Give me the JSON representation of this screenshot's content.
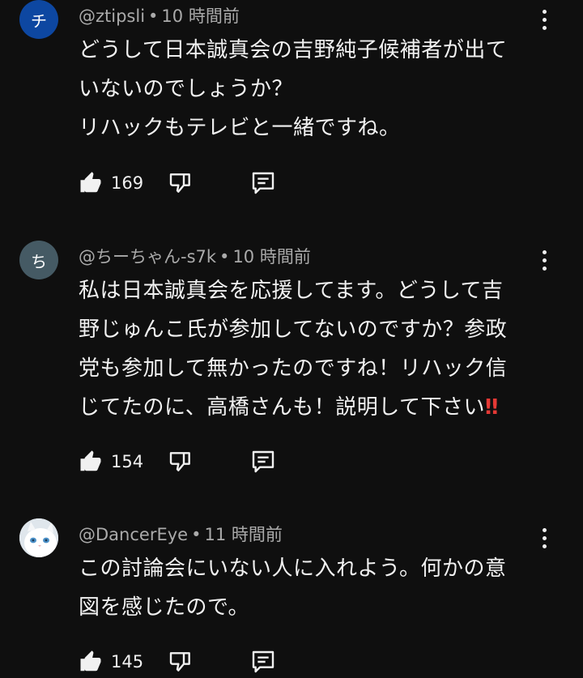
{
  "comments": [
    {
      "avatar_letter": "チ",
      "avatar_color": "#0d47a1",
      "author": "@ztipsli",
      "time": "10 時間前",
      "text": "どうして日本誠真会の吉野純子候補者が出て\nいないのでしょうか？\nリハックもテレビと一緒ですね。",
      "likes": "169"
    },
    {
      "avatar_letter": "ち",
      "avatar_color": "#455a64",
      "author": "@ちーちゃん-s7k",
      "time": "10 時間前",
      "text": "私は日本誠真会を応援してます。どうして吉\n野じゅんこ氏が参加してないのですか？参政\n党も参加して無かったのですね！リハック信\nじてたのに、高橋さんも！説明して下さい",
      "text_suffix": "‼",
      "likes": "154"
    },
    {
      "avatar_letter": "",
      "avatar_color": "#e9eef3",
      "avatar_icon": "white-cat-avatar",
      "author": "@DancerEye",
      "time": "11 時間前",
      "text": "この討論会にいない人に入れよう。何かの意\n図を感じたので。",
      "likes": "145"
    }
  ],
  "separator": "•"
}
